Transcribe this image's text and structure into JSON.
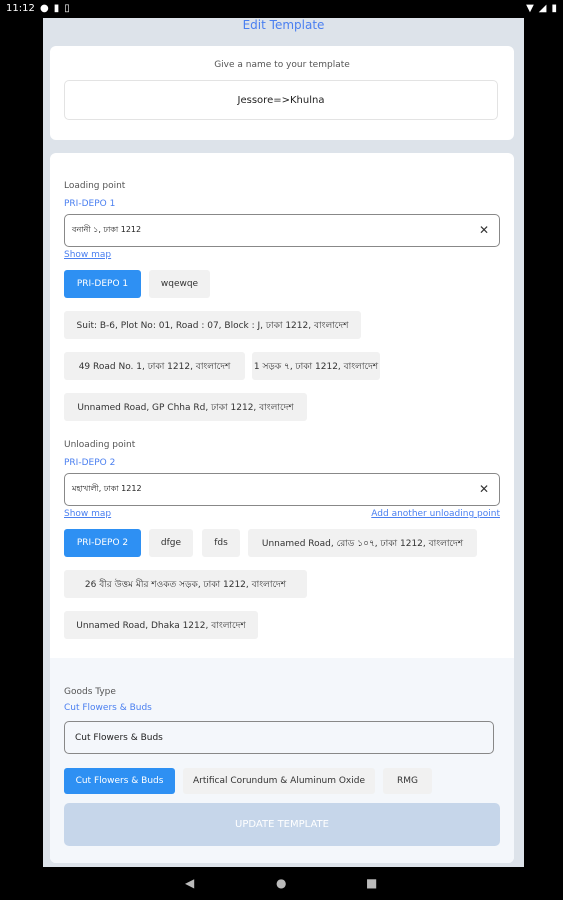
{
  "status_bar": {
    "time": "11:12"
  },
  "header": {
    "title": "Edit Template"
  },
  "template_name": {
    "label": "Give a name to your template",
    "value": "Jessore=>Khulna"
  },
  "loading": {
    "label": "Loading point",
    "selected": "PRI-DEPO 1",
    "search_value": "বনানী ১, ঢাকা 1212",
    "show_map": "Show map",
    "chips": [
      "PRI-DEPO 1",
      "wqewqe",
      "Suit: B-6, Plot No: 01, Road : 07, Block : J, ঢাকা 1212, বাংলাদেশ",
      "49 Road No. 1, ঢাকা 1212, বাংলাদেশ",
      "1 সড়ক ৭, ঢাকা 1212, বাংলাদেশ",
      "Unnamed Road, GP Chha Rd, ঢাকা 1212, বাংলাদেশ"
    ]
  },
  "unloading": {
    "label": "Unloading point",
    "selected": "PRI-DEPO 2",
    "search_value": "মহাখালী, ঢাকা 1212",
    "show_map": "Show map",
    "add_another": "Add another unloading point",
    "chips": [
      "PRI-DEPO 2",
      "dfge",
      "fds",
      "Unnamed Road, রোড ১০৭, ঢাকা 1212, বাংলাদেশ",
      "26 বীর উত্তম মীর শওকত সড়ক, ঢাকা 1212, বাংলাদেশ",
      "Unnamed Road, Dhaka 1212, বাংলাদেশ"
    ]
  },
  "goods": {
    "label": "Goods Type",
    "selected": "Cut Flowers & Buds",
    "input_value": "Cut Flowers & Buds",
    "chips": [
      "Cut Flowers & Buds",
      "Artifical Corundum & Aluminum Oxide",
      "RMG"
    ]
  },
  "update_button": "UPDATE TEMPLATE",
  "colors": {
    "accent": "#2e90f3",
    "link": "#4a7ff0",
    "disabled_button": "#c6d6ea"
  },
  "icons": [
    "chat-icon",
    "sim-icon",
    "storage-icon",
    "wifi-icon",
    "signal-icon",
    "battery-icon",
    "back-icon",
    "home-icon",
    "recents-icon",
    "clear-icon"
  ]
}
